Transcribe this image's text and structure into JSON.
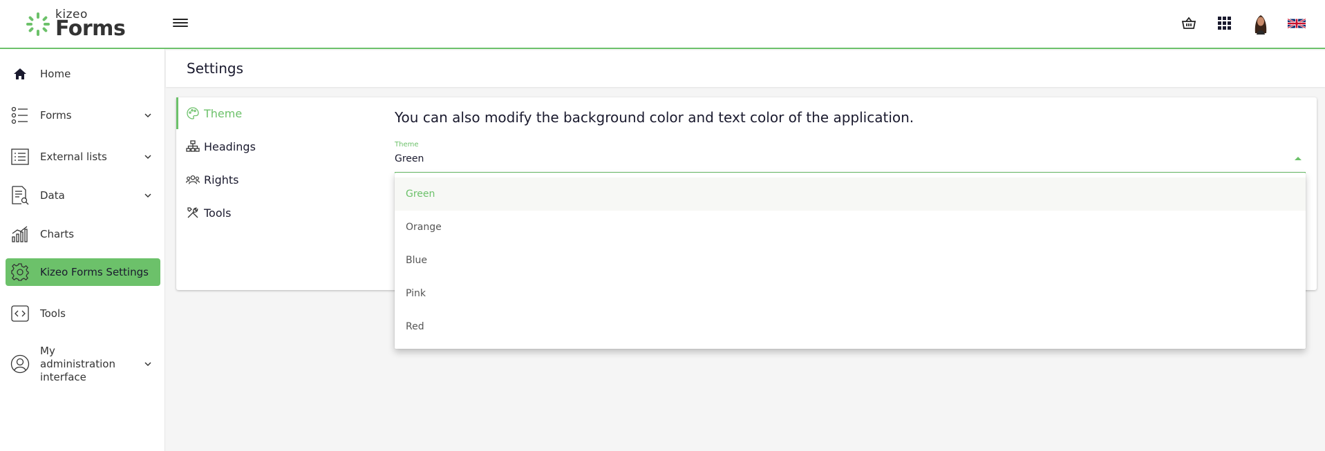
{
  "header": {
    "logo_small": "kizeo",
    "logo_big": "Forms",
    "icons": [
      "basket-icon",
      "apps-grid-icon",
      "avatar",
      "uk-flag-icon"
    ]
  },
  "sidebar": {
    "items": [
      {
        "label": "Home",
        "icon": "home-icon",
        "expandable": false
      },
      {
        "label": "Forms",
        "icon": "forms-icon",
        "expandable": true
      },
      {
        "label": "External lists",
        "icon": "list-icon",
        "expandable": true
      },
      {
        "label": "Data",
        "icon": "data-icon",
        "expandable": true
      },
      {
        "label": "Charts",
        "icon": "chart-icon",
        "expandable": false
      },
      {
        "label": "Kizeo Forms Settings",
        "icon": "gear-icon",
        "expandable": false,
        "active": true
      },
      {
        "label": "Tools",
        "icon": "code-icon",
        "expandable": false
      },
      {
        "label": "My administration interface",
        "icon": "user-circle-icon",
        "expandable": true
      }
    ]
  },
  "page": {
    "title": "Settings"
  },
  "settings": {
    "tabs": [
      {
        "label": "Theme",
        "icon": "palette-icon",
        "active": true
      },
      {
        "label": "Headings",
        "icon": "hierarchy-icon"
      },
      {
        "label": "Rights",
        "icon": "users-icon"
      },
      {
        "label": "Tools",
        "icon": "tools-icon"
      }
    ],
    "description": "You can also modify the background color and text color of the application.",
    "theme_field": {
      "label": "Theme",
      "value": "Green"
    },
    "options": [
      "Green",
      "Orange",
      "Blue",
      "Pink",
      "Red"
    ]
  },
  "colors": {
    "accent": "#6cc16a",
    "text": "#1a1a2e",
    "background": "#f5f5f5"
  }
}
